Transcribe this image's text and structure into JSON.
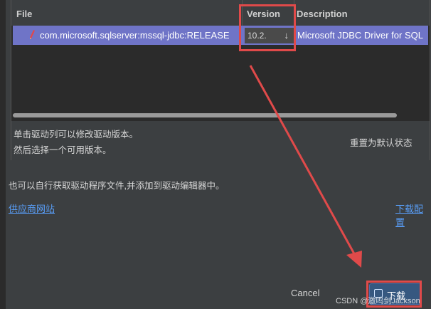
{
  "table": {
    "headers": {
      "file": "File",
      "version": "Version",
      "description": "Description"
    },
    "rows": [
      {
        "file": "com.microsoft.sqlserver:mssql-jdbc:RELEASE",
        "version": "10.2.",
        "description": "Microsoft JDBC Driver for SQL"
      }
    ]
  },
  "hints": {
    "line1": "单击驱动列可以修改驱动版本。",
    "line2": "然后选择一个可用版本。"
  },
  "reset_label": "重置为默认状态",
  "info_text": "也可以自行获取驱动程序文件,并添加到驱动编辑器中。",
  "links": {
    "vendor": "供应商网站",
    "download_config": "下载配置"
  },
  "buttons": {
    "cancel": "Cancel",
    "download": "下载"
  },
  "watermark": "CSDN @激鸣剑Jackson",
  "colors": {
    "selection": "#6f74c7",
    "link": "#589df6",
    "annotation": "#e04a4a",
    "primary_button": "#365880"
  }
}
